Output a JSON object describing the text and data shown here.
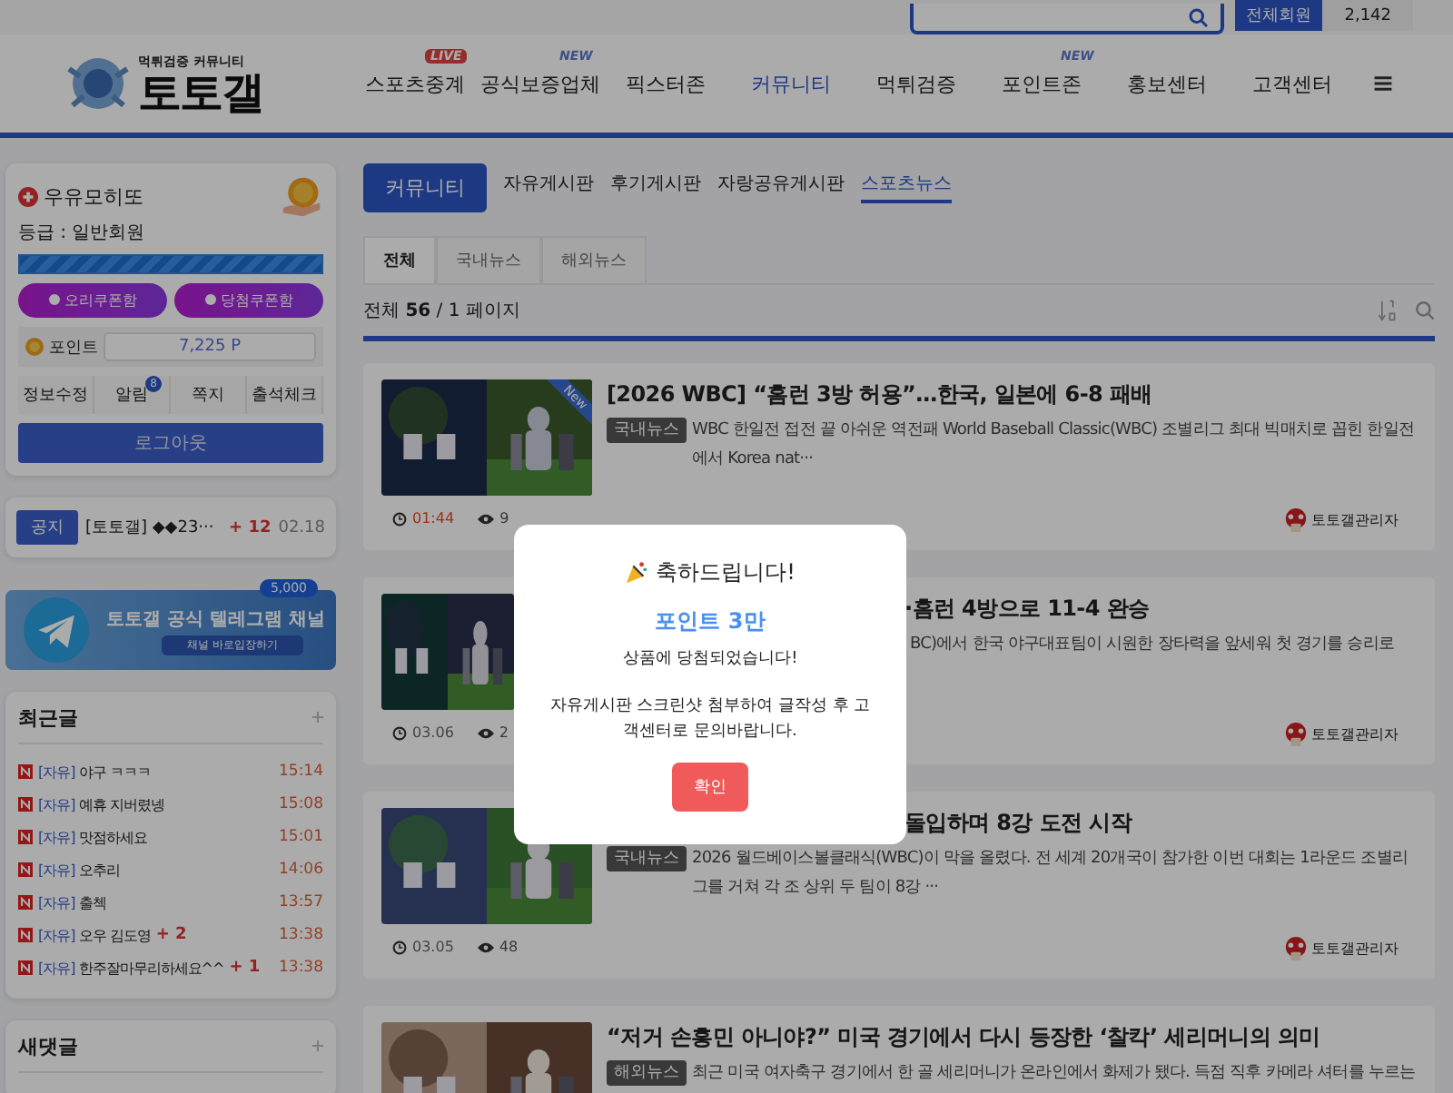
{
  "top_bar": {
    "member_label": "전체회원",
    "member_count": "2,142"
  },
  "header": {
    "logo_tagline": "먹튀검증 커뮤니티",
    "logo_name": "토토갤",
    "nav": [
      {
        "label": "스포츠중계",
        "selected": false,
        "badge": {
          "kind": "live",
          "text": "LIVE"
        }
      },
      {
        "label": "공식보증업체",
        "selected": false,
        "badge": {
          "kind": "new",
          "text": "NEW"
        }
      },
      {
        "label": "픽스터존",
        "selected": false
      },
      {
        "label": "커뮤니티",
        "selected": true
      },
      {
        "label": "먹튀검증",
        "selected": false
      },
      {
        "label": "포인트존",
        "selected": false,
        "badge": {
          "kind": "new",
          "text": "NEW"
        }
      },
      {
        "label": "홍보센터",
        "selected": false
      },
      {
        "label": "고객센터",
        "selected": false
      }
    ]
  },
  "user_card": {
    "name": "우유모히또",
    "grade": "등급 : 일반회원",
    "level": 1,
    "coupons": [
      "오리쿠폰함",
      "당첨쿠폰함"
    ],
    "points_label": "포인트",
    "points": "7,225 P",
    "links": [
      {
        "label": "정보수정"
      },
      {
        "label": "알림",
        "badge": "8"
      },
      {
        "label": "쪽지"
      },
      {
        "label": "출석체크"
      }
    ],
    "logout": "로그아웃"
  },
  "notice": {
    "tag": "공지",
    "text": "[토토갤] ◆◆23···",
    "comments": "+ 12",
    "date": "02.18"
  },
  "banner": {
    "badge": "5,000",
    "title": "토토갤 공식 텔레그램 채널",
    "button": "채널 바로입장하기"
  },
  "recent_posts": {
    "title": "최근글",
    "items": [
      {
        "category": "[자유]",
        "title": "야구 ㅋㅋㅋ",
        "time": "15:14"
      },
      {
        "category": "[자유]",
        "title": "예휴 지버렸넹",
        "time": "15:08"
      },
      {
        "category": "[자유]",
        "title": "맛점하세요",
        "time": "15:01"
      },
      {
        "category": "[자유]",
        "title": "오추리",
        "time": "14:06"
      },
      {
        "category": "[자유]",
        "title": "출첵",
        "time": "13:57"
      },
      {
        "category": "[자유]",
        "title": "오우 김도영",
        "comments": "+ 2",
        "time": "13:38"
      },
      {
        "category": "[자유]",
        "title": "한주잘마무리하세요^^",
        "comments": "+ 1",
        "time": "13:38"
      }
    ]
  },
  "new_comments": {
    "title": "새댓글"
  },
  "board": {
    "section": "커뮤니티",
    "tabs": [
      {
        "label": "자유게시판",
        "selected": false
      },
      {
        "label": "후기게시판",
        "selected": false
      },
      {
        "label": "자랑공유게시판",
        "selected": false
      },
      {
        "label": "스포츠뉴스",
        "selected": true
      }
    ],
    "categories": [
      {
        "label": "전체",
        "selected": true
      },
      {
        "label": "국내뉴스",
        "selected": false
      },
      {
        "label": "해외뉴스",
        "selected": false
      }
    ],
    "count": "전체 **56** / 1 페이지",
    "articles": [
      {
        "title": "[2026 WBC] “홈런 3방 허용”…한국, 일본에 6-8 패배",
        "tag": "국내뉴스",
        "snippet": "WBC 한일전 접전 끝 아쉬운 역전패 World Baseball Classic(WBC) 조별리그 최대 빅매치로 꼽힌 한일전에서 Korea nat···",
        "time": "01:44",
        "recent": true,
        "views": "9",
        "author": "토토갤관리자",
        "ribbon": "New"
      },
      {
        "title": "·홈런 4방으로 11-4 완승",
        "title_cut": true,
        "snippet": "BC)에서 한국 야구대표팀이 시원한 장타력을 앞세워 첫 경기를 승리로",
        "snippet_cut": true,
        "time": "03.06",
        "recent": false,
        "views": "2",
        "author": "토토갤관리자"
      },
      {
        "title": "돌입하며 8강 도전 시작",
        "title_cut": true,
        "tag": "국내뉴스",
        "snippet": "2026 월드베이스볼클래식(WBC)이 막을 올렸다. 전 세계 20개국이 참가한 이번 대회는 1라운드 조별리그를 거쳐 각 조 상위 두 팀이 8강 ···",
        "time": "03.05",
        "recent": false,
        "views": "48",
        "author": "토토갤관리자"
      },
      {
        "title": "“저거 손흥민 아니야?” 미국 경기에서 다시 등장한 ‘찰칵’ 세리머니의 의미",
        "tag": "해외뉴스",
        "snippet": "최근 미국 여자축구 경기에서 한 골 세리머니가 온라인에서 화제가 됐다. 득점 직후 카메라 셔터를 누르는"
      }
    ]
  },
  "modal": {
    "title": "축하드립니다!",
    "prize": "포인트 3만",
    "line": "상품에 당첨되었습니다!",
    "message": "자유게시판 스크린샷 첨부하여 글작성 후 고객센터로 문의바랍니다.",
    "button": "확인"
  }
}
